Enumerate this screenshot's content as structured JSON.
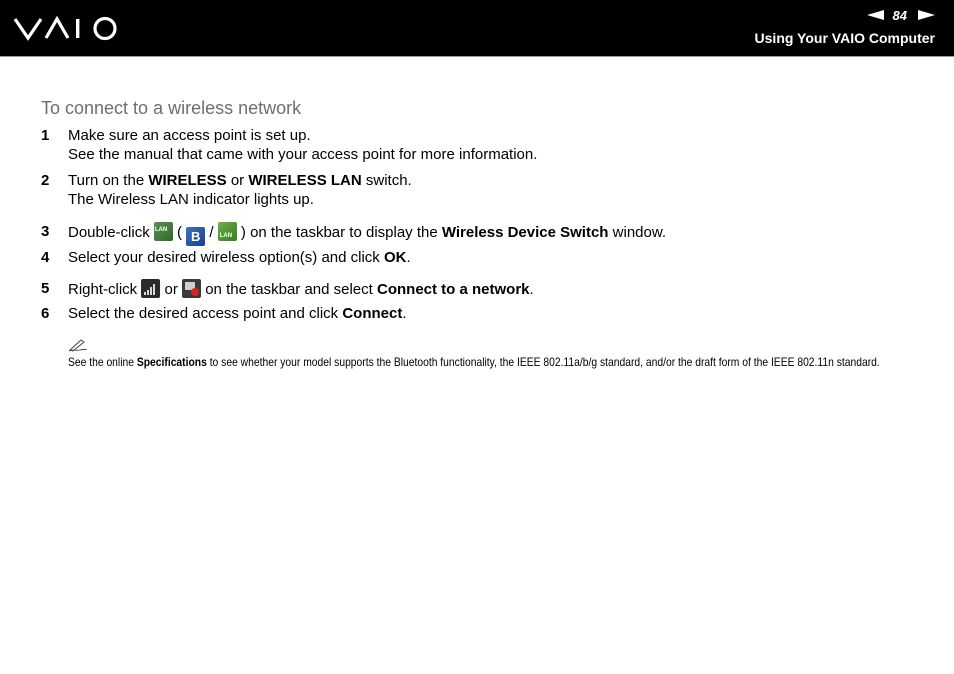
{
  "header": {
    "logo_text": "VAIO",
    "page_number": "84",
    "section_title": "Using Your VAIO Computer"
  },
  "content": {
    "heading": "To connect to a wireless network",
    "steps": [
      {
        "num": "1",
        "line1": "Make sure an access point is set up.",
        "line2": "See the manual that came with your access point for more information."
      },
      {
        "num": "2",
        "pre": "Turn on the ",
        "b1": "WIRELESS",
        "mid": " or ",
        "b2": "WIRELESS LAN",
        "post": " switch.",
        "line2": "The Wireless LAN indicator lights up."
      },
      {
        "num": "3",
        "pre": "Double-click ",
        "sep1": " ( ",
        "sep2": " / ",
        "post": " ) on the taskbar to display the ",
        "bold": "Wireless Device Switch",
        "end": " window."
      },
      {
        "num": "4",
        "pre": "Select your desired wireless option(s) and click ",
        "bold": "OK",
        "end": "."
      },
      {
        "num": "5",
        "pre": "Right-click ",
        "mid": " or ",
        "post": " on the taskbar and select ",
        "bold": "Connect to a network",
        "end": "."
      },
      {
        "num": "6",
        "pre": "Select the desired access point and click ",
        "bold": "Connect",
        "end": "."
      }
    ],
    "note": {
      "pre": "See the online ",
      "bold": "Specifications",
      "post": " to see whether your model supports the Bluetooth functionality, the IEEE 802.11a/b/g standard, and/or the draft form of the IEEE 802.11n standard."
    }
  },
  "icons": {
    "wireless_lan": "wireless-lan-icon",
    "bluetooth": "bluetooth-icon",
    "lan": "lan-icon",
    "signal": "wireless-signal-icon",
    "disconnected": "network-disconnected-icon",
    "note": "pencil-note-icon"
  }
}
